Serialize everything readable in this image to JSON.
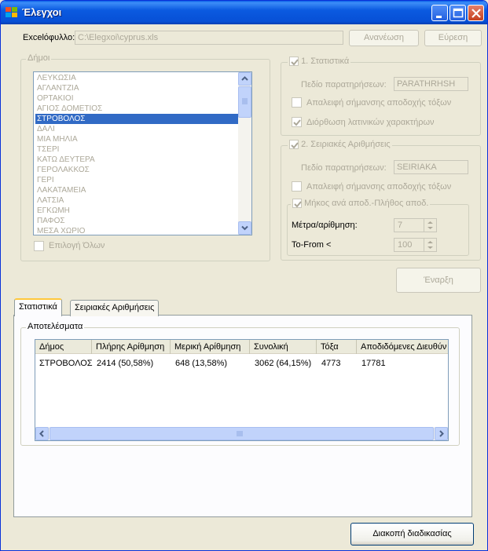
{
  "window": {
    "title": "Έλεγχοι"
  },
  "excel": {
    "label": "Excelόφυλλο:",
    "path": "C:\\Elegxoi\\cyprus.xls",
    "refresh_button": "Ανανέωση",
    "browse_button": "Εύρεση"
  },
  "municipalities": {
    "group_title": "Δήμοι",
    "items": [
      "ΛΕΥΚΩΣΙΑ",
      "ΑΓΛΑΝΤΖΙΑ",
      "ΟΡΤΑΚΙΟΙ",
      "ΑΓΙΟΣ ΔΟΜΕΤΙΟΣ",
      "ΣΤΡΟΒΟΛΟΣ",
      "ΔΑΛΙ",
      "ΜΙΑ ΜΗΛΙΑ",
      "ΤΣΕΡΙ",
      "ΚΑΤΩ ΔΕΥΤΕΡΑ",
      "ΓΕΡΟΛΑΚΚΟΣ",
      "ΓΕΡΙ",
      "ΛΑΚΑΤΑΜΕΙΑ",
      "ΛΑΤΣΙΑ",
      "ΕΓΚΩΜΗ",
      "ΠΑΦΟΣ",
      "ΜΕΣΑ ΧΩΡΙΟ"
    ],
    "selected": "ΣΤΡΟΒΟΛΟΣ",
    "select_all": "Επιλογή Όλων"
  },
  "statistics": {
    "title": "1. Στατιστικά",
    "field_label": "Πεδίο παρατηρήσεων:",
    "field_value": "PARATHRHSH",
    "remove_accents": "Απαλειφή σήμανσης αποδοχής τόξων",
    "fix_latin": "Διόρθωση λατινικών χαρακτήρων"
  },
  "serial": {
    "title": "2. Σειριακές Αριθμήσεις",
    "field_label": "Πεδίο παρατηρήσεων:",
    "field_value": "SEIRIAKA",
    "remove_accents": "Απαλειφή σήμανσης αποδοχής τόξων",
    "length_group": "Μήκος ανά αποδ.-Πλήθος αποδ.",
    "meters_label": "Μέτρα/αρίθμηση:",
    "meters_value": "7",
    "tofrom_label": "To-From <",
    "tofrom_value": "100"
  },
  "start_button": "Έναρξη",
  "tabs": [
    {
      "label": "Στατιστικά"
    },
    {
      "label": "Σειριακές Αριθμήσεις"
    }
  ],
  "results": {
    "group_title": "Αποτελέσματα",
    "columns": [
      "Δήμος",
      "Πλήρης Αρίθμηση",
      "Μερική Αρίθμηση",
      "Συνολική",
      "Τόξα",
      "Αποδιδόμενες Διευθύν"
    ],
    "rows": [
      [
        "ΣΤΡΟΒΟΛΟΣ",
        "2414 (50,58%)",
        "648 (13,58%)",
        "3062 (64,15%)",
        "4773",
        "17781"
      ]
    ]
  },
  "stop_button": "Διακοπή διαδικασίας",
  "colors": {
    "titlebar": "#0750D6",
    "selection": "#316AC5",
    "window_bg": "#ECE9D8"
  }
}
